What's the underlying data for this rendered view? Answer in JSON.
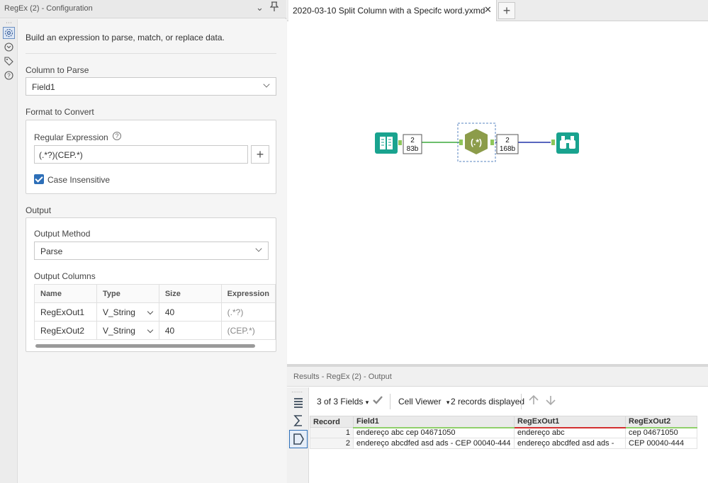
{
  "config": {
    "title": "RegEx (2) - Configuration",
    "description": "Build an expression to parse, match, or replace data.",
    "column_to_parse_label": "Column to Parse",
    "column_to_parse_value": "Field1",
    "format_label": "Format to Convert",
    "regex_label": "Regular Expression",
    "regex_value": "(.*?)(CEP.*)",
    "case_insensitive_label": "Case Insensitive",
    "output_label": "Output",
    "output_method_label": "Output Method",
    "output_method_value": "Parse",
    "output_columns_label": "Output Columns",
    "columns_headers": [
      "Name",
      "Type",
      "Size",
      "Expression"
    ],
    "columns_rows": [
      {
        "name": "RegExOut1",
        "type": "V_String",
        "size": "40",
        "expression": "(.*?)"
      },
      {
        "name": "RegExOut2",
        "type": "V_String",
        "size": "40",
        "expression": "(CEP.*)"
      }
    ]
  },
  "canvas": {
    "tab_title": "2020-03-10 Split Column with a Specifc word.yxmd",
    "conn1_count": "2",
    "conn1_size": "83b",
    "conn2_count": "2",
    "conn2_size": "168b",
    "regex_tool_label": "(.*)"
  },
  "results": {
    "title": "Results - RegEx (2) - Output",
    "fields_label": "3 of 3 Fields",
    "viewer_label": "Cell Viewer",
    "records_label": "2 records displayed",
    "headers": [
      "Record",
      "Field1",
      "RegExOut1",
      "RegExOut2"
    ],
    "rows": [
      {
        "record": "1",
        "field1": "endereço abc cep 04671050",
        "out1": "endereço abc",
        "out2": "cep 04671050"
      },
      {
        "record": "2",
        "field1": "endereço abcdfed asd ads - CEP 00040-444",
        "out1": "endereço abcdfed asd ads -",
        "out2": "CEP 00040-444"
      }
    ]
  },
  "colors": {
    "accent_blue": "#2d6fb8",
    "tool_green": "#19a38f",
    "regex_olive": "#8c9c4a",
    "field1_underline": "#8fd06a",
    "out1_underline": "#d33030"
  }
}
